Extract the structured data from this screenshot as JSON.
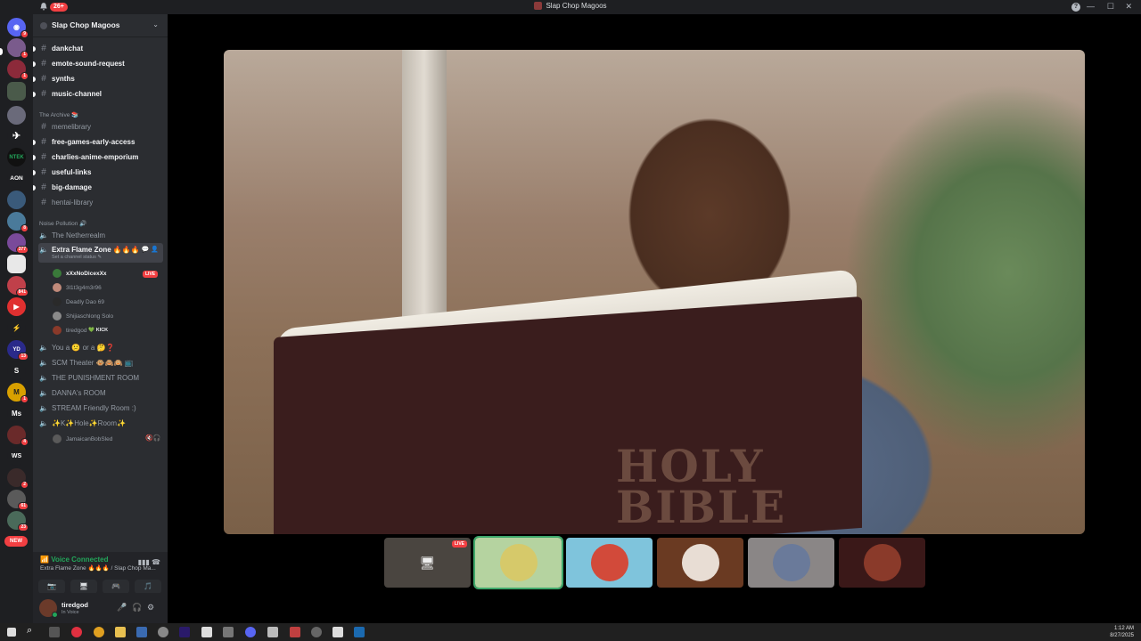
{
  "titlebar": {
    "notification_badge": "26+",
    "title": "Slap Chop Magoos",
    "help": "?",
    "minimize": "—",
    "maximize": "☐",
    "close": "✕"
  },
  "rail": {
    "new_label": "NEW",
    "badges": [
      "9",
      "1",
      "",
      "1",
      "",
      "",
      "",
      "",
      "8",
      "377",
      "",
      "841",
      "",
      "",
      "13",
      "",
      "1",
      "",
      "4",
      "",
      "2",
      "61",
      "23"
    ],
    "text_servers": [
      "AON",
      "S",
      "Ms",
      "WS"
    ]
  },
  "server": {
    "name": "Slap Chop Magoos",
    "chevron": "⌄"
  },
  "channels_top": [
    {
      "label": "dankchat"
    },
    {
      "label": "emote-sound-request"
    },
    {
      "label": "synths"
    },
    {
      "label": "music-channel"
    }
  ],
  "archive": {
    "category": "The Archive 📚",
    "channels": [
      {
        "label": "memelibrary",
        "dim": true
      },
      {
        "label": "free-games-early-access",
        "dim": false
      },
      {
        "label": "charlies-anime-emporium",
        "dim": false
      },
      {
        "label": "useful-links",
        "dim": false
      },
      {
        "label": "big-damage",
        "dim": false
      },
      {
        "label": "hentai-library",
        "dim": true
      }
    ]
  },
  "noise": {
    "category": "Noise Pollution 🔊",
    "netherrealm": "The Netherrealm",
    "active": {
      "label": "Extra Flame Zone 🔥🔥🔥",
      "status": "Set a channel status ✎"
    },
    "users": [
      {
        "name": "xXxNoDicexXx",
        "live": "LIVE"
      },
      {
        "name": "3l1t3g4m3r96"
      },
      {
        "name": "Deadly Dao 69"
      },
      {
        "name": "Shijiaschlong Solo"
      },
      {
        "name": "tiredgod",
        "tag": "💚 KICK"
      }
    ],
    "voice_channels": [
      "You a 😕 or a 🤔❓",
      "SCM Theater 🐵🙈🙉 📺",
      "THE PUNISHMENT ROOM",
      "DANNA's ROOM",
      "STREAM Friendly Room :)",
      "✨K✨Hole✨Room✨"
    ],
    "last_user": "JamaicanBobSled"
  },
  "voice_panel": {
    "status": "Voice Connected",
    "subtitle": "Extra Flame Zone 🔥🔥🔥 / Slap Chop Ma..."
  },
  "user_panel": {
    "name": "tiredgod",
    "status": "In Voice"
  },
  "stage": {
    "book_title": "HOLY\nBIBLE",
    "thumb_live": "LIVE"
  },
  "taskbar": {
    "time": "1:12 AM",
    "date": "8/27/2025"
  },
  "colors": {
    "accent_green": "#23a55a",
    "live_red": "#f23f42"
  }
}
